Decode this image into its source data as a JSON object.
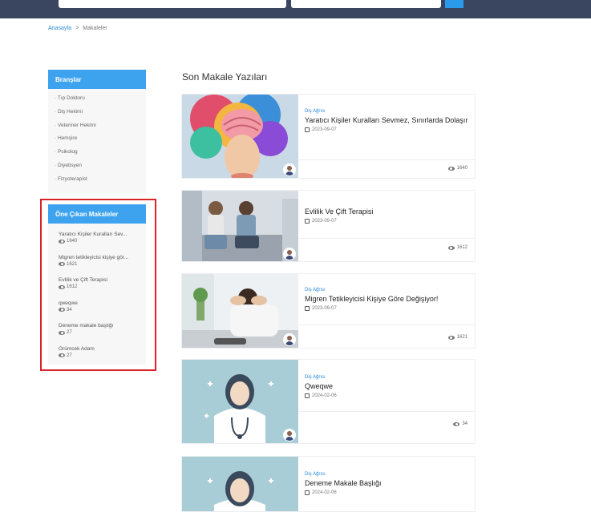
{
  "breadcrumb": {
    "home": "Anasayfa",
    "sep": ">",
    "current": "Makaleler"
  },
  "branches": {
    "title": "Branşlar",
    "items": [
      "Tıp Doktoru",
      "Diş Hekimi",
      "Veteriner Hekimi",
      "Hemşire",
      "Psikolog",
      "Diyetisyen",
      "Fizyoterapist"
    ]
  },
  "popular": {
    "title": "Öne Çıkan Makaleler",
    "items": [
      {
        "title": "Yaratıcı Kişiler Kuralları Sev...",
        "views": "1640"
      },
      {
        "title": "Migren tetikleyicisi kişiye gör...",
        "views": "1621"
      },
      {
        "title": "Evlilik ve Çift Terapisi",
        "views": "1612"
      },
      {
        "title": "qweqwe",
        "views": "34"
      },
      {
        "title": "Deneme makale başlığı",
        "views": "27"
      },
      {
        "title": "Örümcek Adam",
        "views": "27"
      }
    ]
  },
  "main": {
    "title": "Son Makale Yazıları",
    "cards": [
      {
        "category": "Diş Ağrısı",
        "title": "Yaratıcı Kişiler Kuralları Sevmez, Sınırlarda Dolaşır",
        "date": "2023-09-07",
        "views": "1640"
      },
      {
        "category": "",
        "title": "Evlilik Ve Çift Terapisi",
        "date": "2023-09-07",
        "views": "1612"
      },
      {
        "category": "Diş Ağrısı",
        "title": "Migren Tetikleyicisi Kişiye Göre Değişiyor!",
        "date": "2023-09-07",
        "views": "1621"
      },
      {
        "category": "Diş Ağrısı",
        "title": "Qweqwe",
        "date": "2024-02-06",
        "views": "34"
      },
      {
        "category": "Diş Ağrısı",
        "title": "Deneme Makale Başlığı",
        "date": "2024-02-06",
        "views": ""
      }
    ]
  },
  "colors": {
    "accent": "#3ea3ee",
    "topbar": "#3a4660",
    "highlight": "#d8232a",
    "link": "#2a88d8"
  }
}
